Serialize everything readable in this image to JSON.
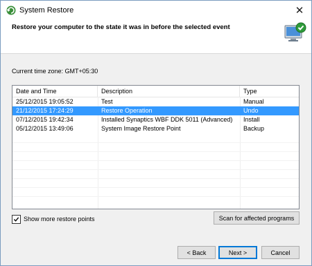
{
  "window": {
    "title": "System Restore"
  },
  "header": {
    "title": "Restore your computer to the state it was in before the selected event"
  },
  "timezone_label": "Current time zone: GMT+05:30",
  "table": {
    "columns": [
      "Date and Time",
      "Description",
      "Type"
    ],
    "rows": [
      {
        "date": "25/12/2015 19:05:52",
        "description": "Test",
        "type": "Manual",
        "selected": false
      },
      {
        "date": "21/12/2015 17:24:29",
        "description": "Restore Operation",
        "type": "Undo",
        "selected": true
      },
      {
        "date": "07/12/2015 19:42:34",
        "description": "Installed Synaptics WBF DDK 5011 (Advanced)",
        "type": "Install",
        "selected": false
      },
      {
        "date": "05/12/2015 13:49:06",
        "description": "System Image Restore Point",
        "type": "Backup",
        "selected": false
      }
    ]
  },
  "show_more": {
    "label": "Show more restore points",
    "checked": true
  },
  "buttons": {
    "scan": "Scan for affected programs",
    "back": "< Back",
    "next": "Next >",
    "cancel": "Cancel"
  },
  "colors": {
    "selection": "#3399ff",
    "content_bg": "#f0f0f0",
    "default_button_border": "#0078d7"
  },
  "icons": [
    "system-restore-icon",
    "close-icon",
    "restore-computer-icon",
    "checkmark-icon"
  ]
}
